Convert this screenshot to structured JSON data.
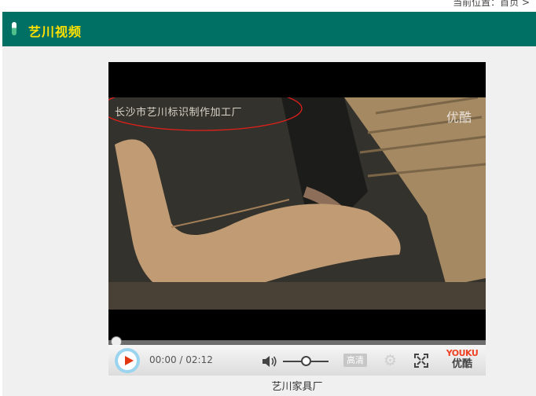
{
  "page": {
    "breadcrumb": "当前位置：首页 >"
  },
  "header": {
    "title": "艺川视频"
  },
  "player": {
    "caption": "长沙市艺川标识制作加工厂",
    "watermark": "优酷",
    "time": "00:00 / 02:12",
    "quality": "高清",
    "brand_en": "YOUKU",
    "brand_cn": "优酷"
  },
  "video_caption": "艺川家具厂",
  "colors": {
    "header_bg": "#006f64",
    "title": "#ffe100",
    "annotation": "#e0201a"
  }
}
